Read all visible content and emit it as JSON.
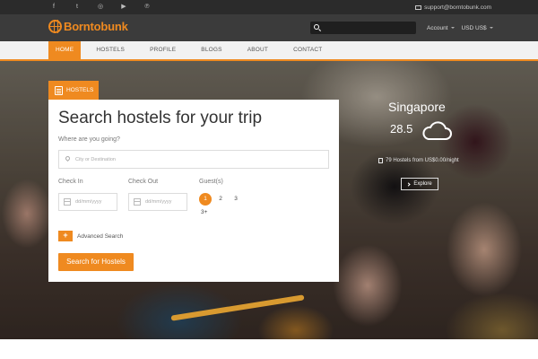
{
  "topbar": {
    "social_icons": [
      "facebook-icon",
      "twitter-icon",
      "instagram-icon",
      "youtube-icon",
      "pinterest-icon"
    ],
    "social_glyphs": [
      "f",
      "t",
      "◎",
      "▶",
      "℗"
    ],
    "email": "support@borntobunk.com"
  },
  "header": {
    "brand": "Borntobunk",
    "account_label": "Account",
    "currency_label": "USD US$"
  },
  "nav": {
    "items": [
      "HOME",
      "HOSTELS",
      "PROFILE",
      "BLOGS",
      "ABOUT",
      "CONTACT"
    ],
    "active_index": 0
  },
  "search": {
    "tab_label": "HOSTELS",
    "title": "Search hostels for your trip",
    "where_label": "Where are you going?",
    "city_placeholder": "City or Destination",
    "checkin_label": "Check In",
    "checkout_label": "Check Out",
    "date_placeholder": "dd/mm/yyyy",
    "guests_label": "Guest(s)",
    "guest_options": [
      "1",
      "2",
      "3",
      "3+"
    ],
    "guest_selected": "1",
    "advanced_label": "Advanced Search",
    "advanced_glyph": "+",
    "submit_label": "Search for Hostels"
  },
  "destination": {
    "city": "Singapore",
    "temperature": "28.5",
    "weather_icon": "cloud-icon",
    "hostels_text": "79 Hostels from US$0.00/night",
    "explore_label": "Explore"
  },
  "colors": {
    "accent": "#ef8a20",
    "topbar_bg": "#2b2b2b",
    "header_bg": "#3b3b3b"
  }
}
